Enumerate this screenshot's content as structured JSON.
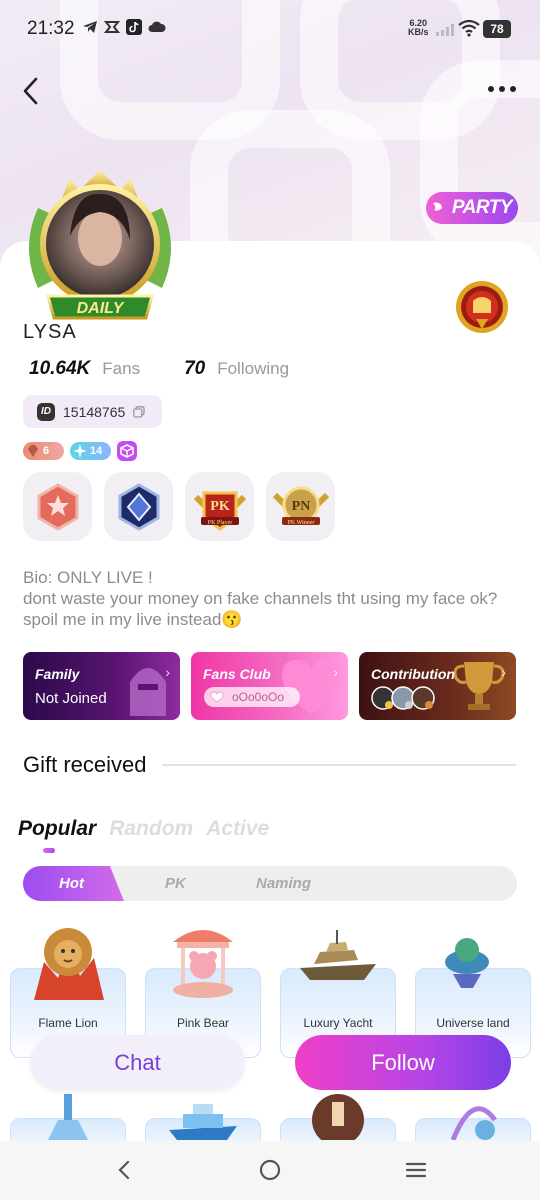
{
  "status_bar": {
    "time": "21:32",
    "net_speed_value": "6.20",
    "net_speed_unit": "KB/s",
    "battery": "78"
  },
  "header": {
    "party_label": "PARTY"
  },
  "profile": {
    "avatar_badge": "DAILY",
    "username": "LYSA",
    "fans_count": "10.64K",
    "fans_label": "Fans",
    "following_count": "70",
    "following_label": "Following",
    "id_label": "ID",
    "id_value": "15148765",
    "wealth_level": "6",
    "charm_level": "14",
    "medals": [
      {
        "name": "red-rank-medal"
      },
      {
        "name": "blue-rank-medal"
      },
      {
        "name": "pk-player-medal",
        "label": "PK Player"
      },
      {
        "name": "pk-winner-medal",
        "label": "PK Winner"
      }
    ],
    "bio_line1": "Bio: ONLY LIVE !",
    "bio_line2": "dont waste your money on fake channels tht using my face ok?",
    "bio_line3": "spoil me in my live instead😗"
  },
  "clubs": {
    "family_title": "Family",
    "family_status": "Not Joined",
    "fans_club_title": "Fans Club",
    "fans_club_name": "oOo0oOo",
    "contribution_title": "Contribution"
  },
  "gifts": {
    "section_title": "Gift received",
    "category_tabs": [
      "Popular",
      "Random",
      "Active"
    ],
    "sub_tabs": [
      "Hot",
      "PK",
      "Naming"
    ],
    "items": [
      {
        "name": "Flame Lion"
      },
      {
        "name": "Pink Bear"
      },
      {
        "name": "Luxury Yacht"
      },
      {
        "name": "Universe land"
      }
    ]
  },
  "actions": {
    "chat_label": "Chat",
    "follow_label": "Follow"
  },
  "colors": {
    "accent_purple": "#9c4cf0",
    "accent_pink": "#ef3fc8",
    "chat_text": "#7a3fd6"
  }
}
